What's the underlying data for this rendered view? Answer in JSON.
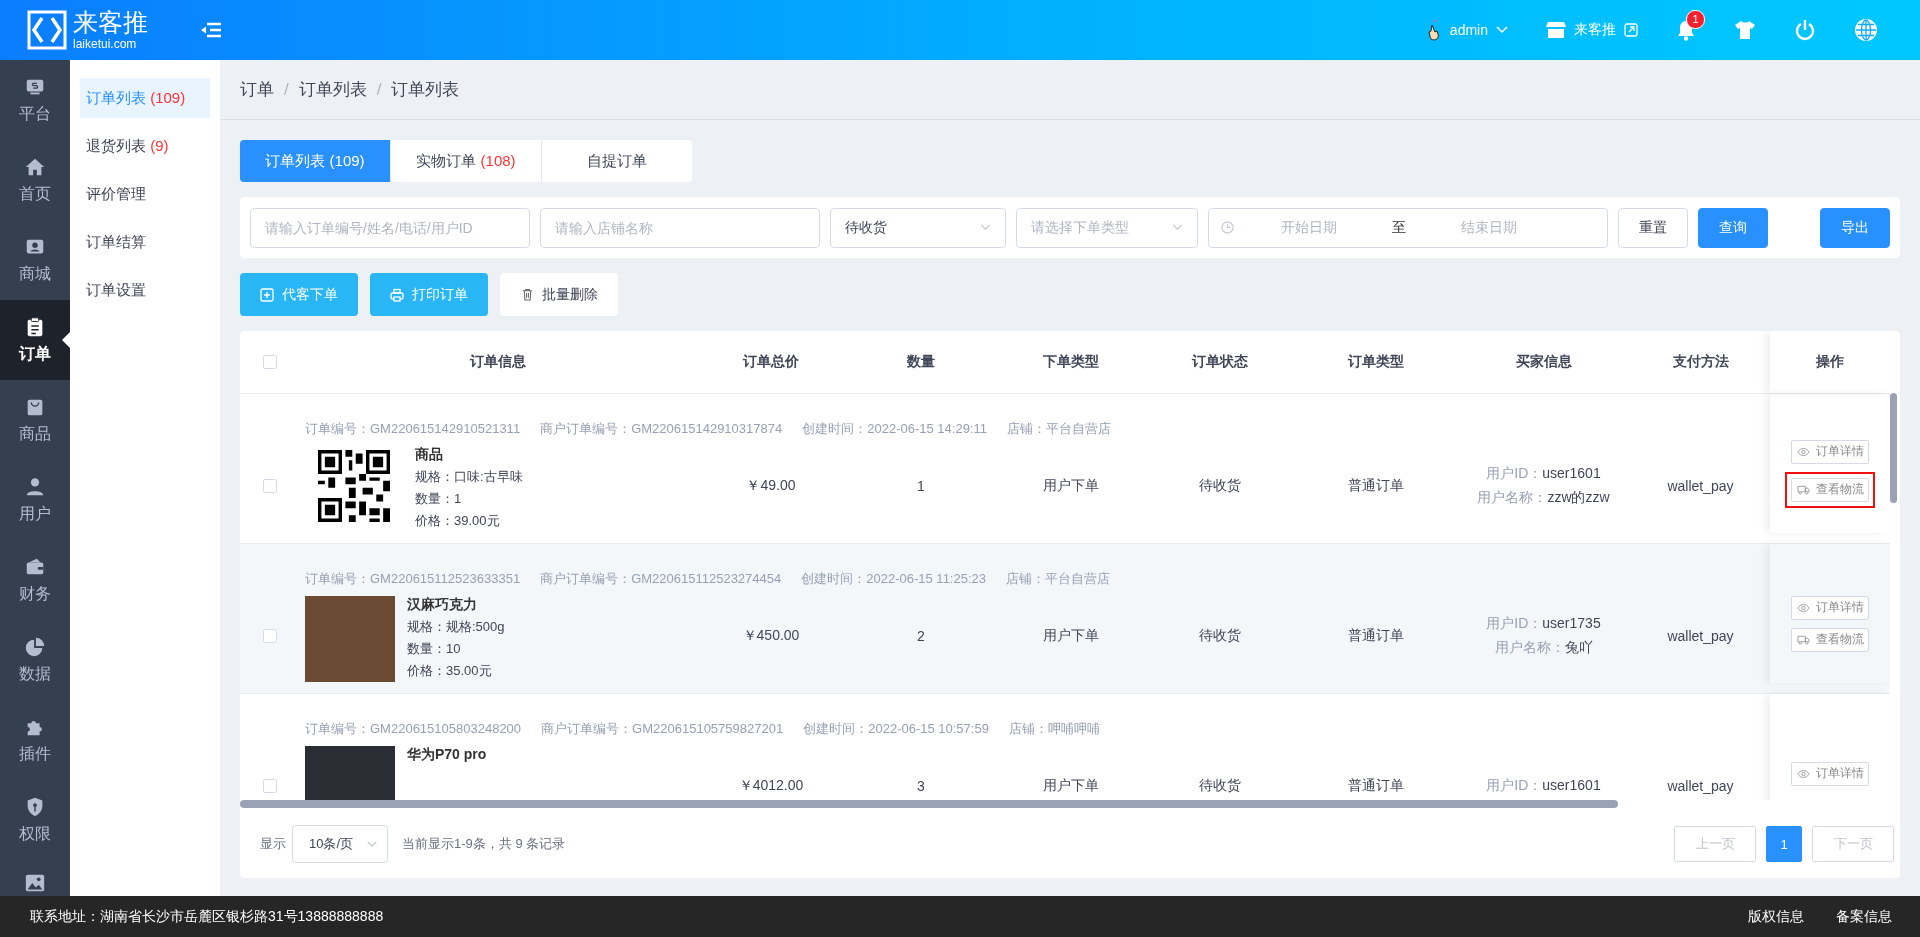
{
  "header": {
    "logo_title": "来客推",
    "logo_subtitle": "laiketui.com",
    "user": "admin",
    "store": "来客推",
    "notification_count": "1"
  },
  "nav_rail": [
    {
      "label": "平台",
      "selected": false
    },
    {
      "label": "首页",
      "selected": false
    },
    {
      "label": "商城",
      "selected": false
    },
    {
      "label": "订单",
      "selected": true
    },
    {
      "label": "商品",
      "selected": false
    },
    {
      "label": "用户",
      "selected": false
    },
    {
      "label": "财务",
      "selected": false
    },
    {
      "label": "数据",
      "selected": false
    },
    {
      "label": "插件",
      "selected": false
    },
    {
      "label": "权限",
      "selected": false
    }
  ],
  "sub_nav": [
    {
      "label": "订单列表",
      "count": "(109)",
      "selected": true
    },
    {
      "label": "退货列表",
      "count": "(9)",
      "selected": false
    },
    {
      "label": "评价管理",
      "selected": false
    },
    {
      "label": "订单结算",
      "selected": false
    },
    {
      "label": "订单设置",
      "selected": false
    }
  ],
  "breadcrumb": {
    "separator": "/",
    "items": [
      "订单",
      "订单列表",
      "订单列表"
    ]
  },
  "tabs": [
    {
      "label": "订单列表",
      "count": "(109)",
      "selected": true
    },
    {
      "label": "实物订单",
      "count": "(108)",
      "selected": false
    },
    {
      "label": "自提订单",
      "selected": false
    }
  ],
  "filters": {
    "keyword": {
      "placeholder": "请输入订单编号/姓名/电话/用户ID"
    },
    "store": {
      "placeholder": "请输入店铺名称"
    },
    "status": {
      "value": "待收货"
    },
    "order_type": {
      "placeholder": "请选择下单类型"
    },
    "date_range": {
      "start_placeholder": "开始日期",
      "separator": "至",
      "end_placeholder": "结束日期"
    },
    "buttons": [
      {
        "label": "重置",
        "kind": "default"
      },
      {
        "label": "查询",
        "kind": "primary"
      }
    ],
    "export": "导出"
  },
  "actions": [
    {
      "label": "代客下单",
      "kind": "add"
    },
    {
      "label": "打印订单",
      "kind": "print"
    },
    {
      "label": "批量删除",
      "kind": "delete"
    }
  ],
  "table": {
    "select_all_checked": false,
    "columns": [
      "订单信息",
      "订单总价",
      "数量",
      "下单类型",
      "订单状态",
      "订单类型",
      "买家信息",
      "支付方法",
      "操作"
    ],
    "rows": [
      {
        "checked": false,
        "meta": [
          "订单编号：GM220615142910521311",
          "商户订单编号：GM220615142910317874",
          "创建时间：2022-06-15 14:29:11",
          "店铺：平台自营店"
        ],
        "product": {
          "kind": "qr",
          "name": "商品",
          "lines": [
            "规格：口味:古早味",
            "数量：1",
            "价格：39.00元"
          ]
        },
        "total": "￥49.00",
        "quantity": "1",
        "source": "用户下单",
        "status": "待收货",
        "order_type": "普通订单",
        "buyer": [
          {
            "label": "用户ID：",
            "value": "user1601"
          },
          {
            "label": "用户名称：",
            "value": "zzw的zzw"
          }
        ],
        "payment": "wallet_pay",
        "actions": [
          {
            "label": "订单详情",
            "kind": "detail",
            "highlighted": false
          },
          {
            "label": "查看物流",
            "kind": "logistics",
            "highlighted": true
          }
        ]
      },
      {
        "checked": false,
        "meta": [
          "订单编号：GM220615112523633351",
          "商户订单编号：GM220615112523274454",
          "创建时间：2022-06-15 11:25:23",
          "店铺：平台自营店"
        ],
        "product": {
          "kind": "photo",
          "name": "汉麻巧克力",
          "lines": [
            "规格：规格:500g",
            "数量：10",
            "价格：35.00元"
          ]
        },
        "total": "￥450.00",
        "quantity": "2",
        "source": "用户下单",
        "status": "待收货",
        "order_type": "普通订单",
        "buyer": [
          {
            "label": "用户ID：",
            "value": "user1735"
          },
          {
            "label": "用户名称：",
            "value": "兔吖"
          }
        ],
        "payment": "wallet_pay",
        "actions": [
          {
            "label": "订单详情",
            "kind": "detail",
            "highlighted": false
          },
          {
            "label": "查看物流",
            "kind": "logistics",
            "highlighted": false
          }
        ]
      },
      {
        "checked": false,
        "meta": [
          "订单编号：GM220615105803248200",
          "商户订单编号：GM220615105759827201",
          "创建时间：2022-06-15 10:57:59",
          "店铺：呷哺呷哺"
        ],
        "product": {
          "kind": "photo",
          "name": "华为P70 pro"
        },
        "total": "￥4012.00",
        "quantity": "3",
        "source": "用户下单",
        "status": "待收货",
        "order_type": "普通订单",
        "buyer": [
          {
            "label": "用户ID：",
            "value": "user1601"
          }
        ],
        "payment": "wallet_pay",
        "actions": [
          {
            "label": "订单详情",
            "kind": "detail",
            "highlighted": false
          }
        ]
      }
    ]
  },
  "pagination": {
    "show_label": "显示",
    "page_size": "10条/页",
    "summary": "当前显示1-9条，共 9 条记录",
    "prev": {
      "label": "上一页",
      "disabled": true
    },
    "pages": [
      {
        "label": "1",
        "selected": true
      }
    ],
    "next": {
      "label": "下一页",
      "disabled": true
    }
  },
  "footer": {
    "address": "联系地址：湖南省长沙市岳麓区银杉路31号13888888888",
    "links": [
      "版权信息",
      "备案信息"
    ]
  }
}
